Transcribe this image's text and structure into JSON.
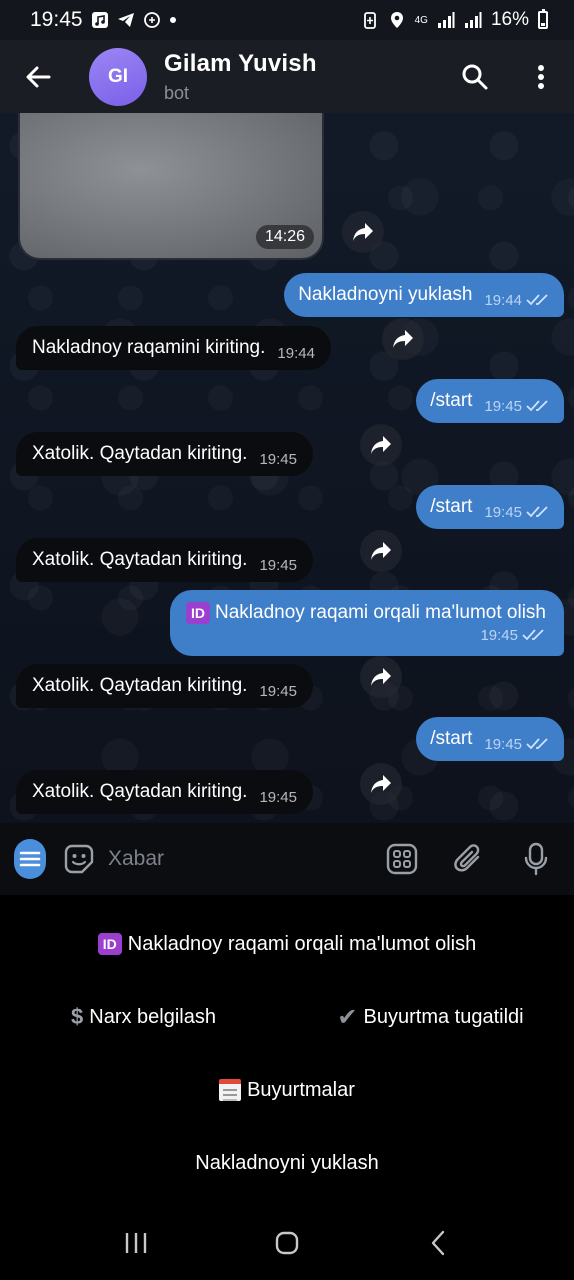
{
  "status_bar": {
    "time": "19:45",
    "network": "4G",
    "battery": "16%",
    "icons": [
      "music-icon",
      "telegram-icon",
      "whatsapp-icon",
      "dot-icon",
      "battery-saver-icon",
      "location-icon",
      "signal-icon",
      "signal-icon",
      "battery-icon"
    ]
  },
  "header": {
    "avatar_initials": "GI",
    "title": "Gilam Yuvish",
    "subtitle": "bot",
    "avatar_color": "#8a72f0"
  },
  "chat": {
    "photo_time": "14:26",
    "messages": [
      {
        "dir": "out",
        "text": "Nakladnoyni yuklash",
        "time": "19:44"
      },
      {
        "dir": "in",
        "text": "Nakladnoy raqamini kiriting.",
        "time": "19:44"
      },
      {
        "dir": "out",
        "text": "/start",
        "time": "19:45"
      },
      {
        "dir": "in",
        "text": "Xatolik. Qaytadan kiriting.",
        "time": "19:45"
      },
      {
        "dir": "out",
        "text": "/start",
        "time": "19:45"
      },
      {
        "dir": "in",
        "text": "Xatolik. Qaytadan kiriting.",
        "time": "19:45"
      },
      {
        "dir": "out",
        "badge": "ID",
        "text": "Nakladnoy raqami orqali ma'lumot olish",
        "time": "19:45"
      },
      {
        "dir": "in",
        "text": "Xatolik. Qaytadan kiriting.",
        "time": "19:45"
      },
      {
        "dir": "out",
        "text": "/start",
        "time": "19:45"
      },
      {
        "dir": "in",
        "text": "Xatolik. Qaytadan kiriting.",
        "time": "19:45"
      }
    ]
  },
  "input": {
    "placeholder": "Xabar"
  },
  "keyboard": {
    "row1": {
      "badge": "ID",
      "label": "Nakladnoy raqami orqali ma'lumot olish"
    },
    "row2": [
      {
        "icon": "dollar-icon",
        "symbol": "$",
        "label": "Narx belgilash"
      },
      {
        "icon": "check-icon",
        "symbol": "✔",
        "label": "Buyurtma tugatildi"
      }
    ],
    "row3": {
      "icon": "calendar-icon",
      "label": "Buyurtmalar"
    },
    "row4": {
      "label": "Nakladnoyni yuklash"
    }
  },
  "colors": {
    "accent": "#4a8edc",
    "outgoing_bubble": "#3f7ec8",
    "incoming_bubble": "#0b0c0f",
    "header_bg": "#1a1d24",
    "id_badge": "#9b3fcf"
  }
}
